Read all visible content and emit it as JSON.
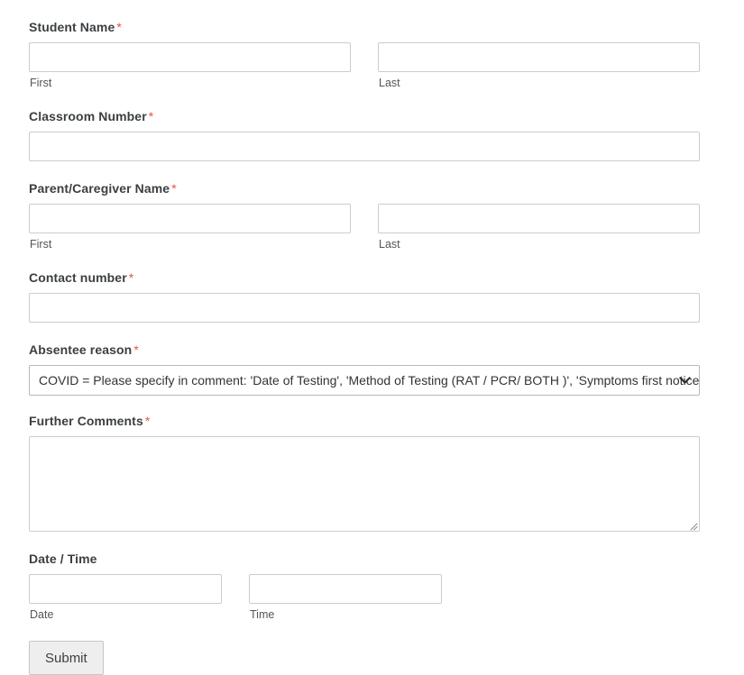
{
  "form": {
    "fields": [
      {
        "key": "student_name",
        "label": "Student Name",
        "required_mark": "*",
        "sub_first": "First",
        "sub_last": "Last",
        "value_first": "",
        "value_last": ""
      },
      {
        "key": "classroom_number",
        "label": "Classroom Number",
        "required_mark": "*",
        "value": ""
      },
      {
        "key": "parent_caregiver_name",
        "label": "Parent/Caregiver Name",
        "required_mark": "*",
        "sub_first": "First",
        "sub_last": "Last",
        "value_first": "",
        "value_last": ""
      },
      {
        "key": "contact_number",
        "label": "Contact number",
        "required_mark": "*",
        "value": ""
      },
      {
        "key": "absentee_reason",
        "label": "Absentee reason",
        "required_mark": "*",
        "selected_option": "COVID = Please specify in comment: 'Date of Testing', 'Method of Testing (RAT / PCR/ BOTH )', 'Symptoms first noticed'",
        "chevron_icon": "chevron-down-icon"
      },
      {
        "key": "further_comments",
        "label": "Further Comments",
        "required_mark": "*",
        "value": "",
        "resize_icon": "resize-grip-icon"
      },
      {
        "key": "date_time",
        "label": "Date / Time",
        "required_mark": "",
        "sub_date": "Date",
        "sub_time": "Time",
        "value_date": "",
        "value_time": ""
      }
    ],
    "submit_label": "Submit"
  },
  "colors": {
    "label": "#3b3f42",
    "required_asterisk": "#e8533c",
    "input_border": "#cccccc",
    "select_border": "#b9b9b9",
    "sub_label": "#555555",
    "button_bg": "#eeeeee",
    "button_border": "#c6c6c6",
    "page_bg": "#ffffff"
  }
}
